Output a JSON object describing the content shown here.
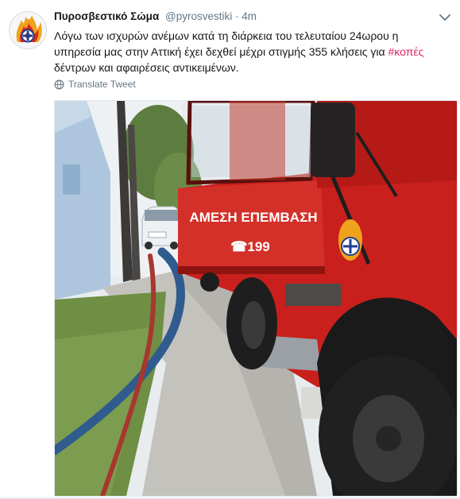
{
  "tweet": {
    "author_name": "Πυροσβεστικό Σώμα",
    "author_handle": "@pyrosvestiki",
    "separator": "·",
    "timestamp": "4m",
    "text_before_hashtag": "Λόγω των ισχυρών ανέμων κατά τη διάρκεια του τελευταίου 24ωρου η υπηρεσία μας στην Αττική έχει δεχθεί μέχρι στιγμής 355 κλήσεις για ",
    "hashtag": "#κοπές",
    "text_after_hashtag": " δέντρων και αφαιρέσεις αντικειμένων.",
    "translate_label": "Translate Tweet"
  },
  "media": {
    "truck_door_text": "ΑΜΕΣΗ ΕΠΕΜΒΑΣΗ",
    "truck_phone": "☎199"
  },
  "colors": {
    "hashtag": "#e0245e",
    "secondary_text": "#657786",
    "truck_red": "#c9201d"
  },
  "icons": {
    "avatar": "fire-service-logo",
    "menu": "chevron-down-icon",
    "translate": "globe-icon"
  }
}
